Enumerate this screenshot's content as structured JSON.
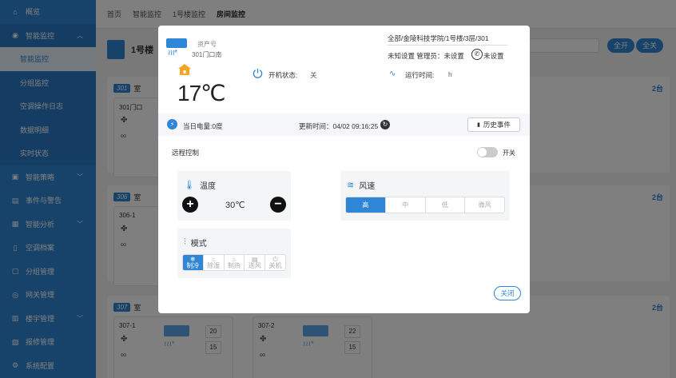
{
  "sidebar": {
    "items": [
      {
        "label": "概览",
        "icon": "home-icon"
      },
      {
        "label": "智能监控",
        "icon": "eye-icon",
        "expanded": true
      },
      {
        "label": "智能监控",
        "sub": true,
        "active": true
      },
      {
        "label": "分组监控",
        "sub": true
      },
      {
        "label": "空调操作日志",
        "sub": true
      },
      {
        "label": "数据明细",
        "sub": true
      },
      {
        "label": "实时状态",
        "sub": true
      },
      {
        "label": "智能策略",
        "icon": "strategy-icon"
      },
      {
        "label": "事件与警告",
        "icon": "alert-icon"
      },
      {
        "label": "智能分析",
        "icon": "chart-icon"
      },
      {
        "label": "空调档案",
        "icon": "file-icon"
      },
      {
        "label": "分组管理",
        "icon": "group-icon"
      },
      {
        "label": "网关管理",
        "icon": "gateway-icon"
      },
      {
        "label": "楼宇管理",
        "icon": "building-icon"
      },
      {
        "label": "报修管理",
        "icon": "repair-icon"
      },
      {
        "label": "系统配置",
        "icon": "settings-icon"
      }
    ]
  },
  "topbar": {
    "crumbs": [
      "首页",
      "智能监控",
      "1号楼监控",
      "房间监控"
    ]
  },
  "background": {
    "building": "1号楼",
    "btn_all_on": "全开",
    "btn_all_off": "全关",
    "rooms": [
      {
        "badge": "301",
        "label": "室",
        "count": "2台",
        "card": "301门口"
      },
      {
        "badge": "306",
        "label": "室",
        "count": "2台",
        "card": "306-1"
      },
      {
        "badge": "307",
        "label": "室",
        "count": "2台",
        "cards": [
          {
            "name": "307-1",
            "t1": "20",
            "t2": "15"
          },
          {
            "name": "307-2",
            "t1": "22",
            "t2": "15"
          }
        ]
      }
    ]
  },
  "modal": {
    "asset_label": "资产号",
    "asset_name": "301门口南",
    "temperature": "17℃",
    "power_label": "开机状态:",
    "power_value": "关",
    "location": "全部/金陵科技学院/1号楼/3层/301",
    "manager_text": "未知设置  管理员：未设置",
    "phone_value": "未设置",
    "run_label": "运行时间:",
    "run_value": "h",
    "electricity": "当日电量:0度",
    "update_time": "更新时间：04/02 09:16:25",
    "history_btn": "历史事件",
    "remote_label": "远程控制",
    "toggle_label": "开关",
    "temp_panel_title": "温度",
    "set_temp": "30℃",
    "mode_panel_title": "模式",
    "modes": [
      {
        "label": "制冷",
        "icon": "❄",
        "selected": true
      },
      {
        "label": "除湿",
        "icon": "♨",
        "selected": false
      },
      {
        "label": "制热",
        "icon": "♨",
        "selected": false
      },
      {
        "label": "送风",
        "icon": "▤",
        "selected": false
      },
      {
        "label": "关机",
        "icon": "⏻",
        "selected": false
      }
    ],
    "wind_panel_title": "风速",
    "winds": [
      {
        "label": "高",
        "selected": true
      },
      {
        "label": "中",
        "selected": false
      },
      {
        "label": "低",
        "selected": false
      },
      {
        "label": "微风",
        "selected": false
      }
    ],
    "close_btn": "关闭"
  },
  "colors": {
    "primary": "#2f86d6",
    "house": "#f5a623"
  }
}
